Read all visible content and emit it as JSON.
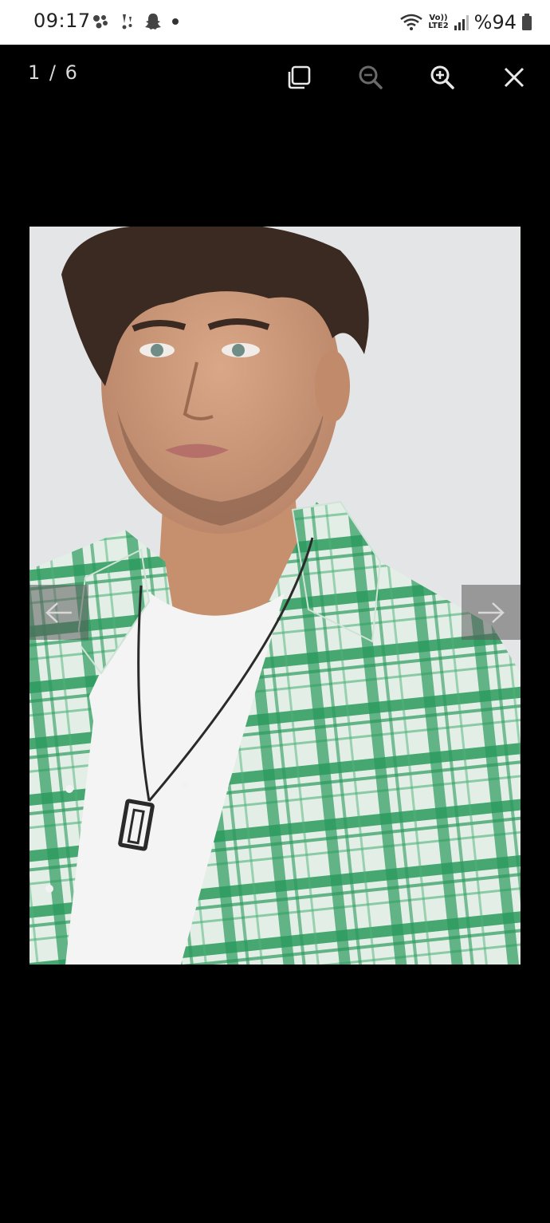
{
  "status_bar": {
    "time": "09:17",
    "notification_icons": [
      "assistant-icon",
      "vibration-icon",
      "snapchat-icon",
      "dot-icon"
    ],
    "network_label": "Vo))\nLTE2",
    "battery_text": "%94"
  },
  "viewer": {
    "counter": "1 / 6",
    "toolbar": [
      "copy-icon",
      "zoom-out-icon",
      "zoom-in-icon",
      "close-icon"
    ],
    "image_alt": "Man wearing green plaid flannel shirt over white t-shirt with pendant necklace"
  },
  "colors": {
    "shirt_green": "#2a9a5c",
    "shirt_light": "#d9ece0",
    "background": "#000000",
    "photo_bg": "#e4e5e7"
  }
}
